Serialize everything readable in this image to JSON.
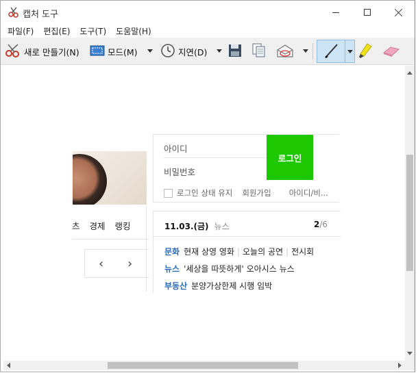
{
  "window": {
    "title": "캡처 도구"
  },
  "menu": {
    "items": [
      "파일(F)",
      "편집(E)",
      "도구(T)",
      "도움말(H)"
    ]
  },
  "toolbar": {
    "new_label": "새로 만들기(N)",
    "mode_label": "모드(M)",
    "delay_label": "지연(D)"
  },
  "capture": {
    "login": {
      "id_placeholder": "아이디",
      "pw_placeholder": "비밀번호",
      "button": "로그인",
      "keep_login": "로그인 상태 유지",
      "signup": "회원가입",
      "find": "아이디/비..."
    },
    "nav": {
      "items": [
        "츠",
        "경제",
        "랭킹"
      ]
    },
    "news": {
      "date": "11.03.(금)",
      "label": "뉴스",
      "page_current": "2",
      "page_total": "/6",
      "lines": [
        {
          "category": "문화",
          "parts": [
            "현재 상영 영화",
            "오늘의 공연",
            "전시회"
          ]
        },
        {
          "category": "뉴스",
          "parts": [
            "'세상을 따뜻하게' 오아시스 뉴스"
          ]
        },
        {
          "category": "부동산",
          "parts": [
            "분양가상한제 시행 임박"
          ]
        }
      ]
    }
  },
  "colors": {
    "login_green": "#1ec800",
    "news_category": "#2a6ab8",
    "pen_selected_bg": "#cde4f7"
  },
  "icons": [
    "snipping-tool-icon",
    "scissors-icon",
    "mode-rect-icon",
    "clock-icon",
    "save-disk-icon",
    "copy-icon",
    "send-envelope-icon",
    "pen-icon",
    "highlighter-icon",
    "eraser-icon"
  ]
}
